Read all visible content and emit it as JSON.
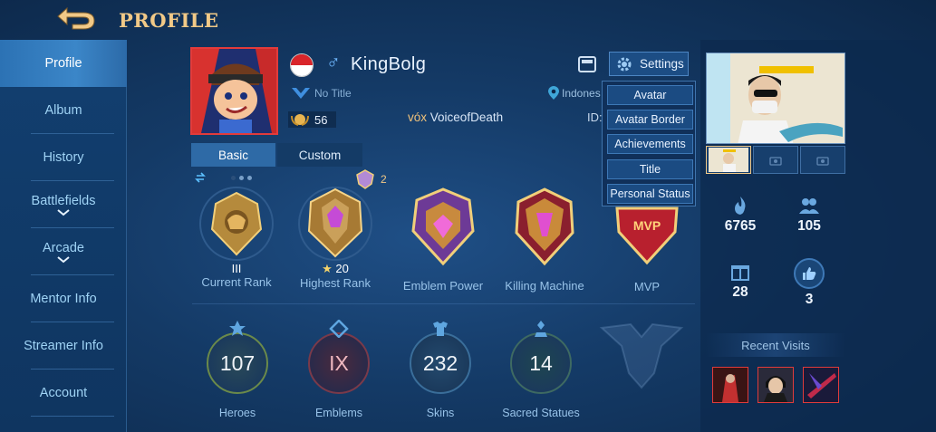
{
  "header": {
    "title": "PROFILE",
    "back_icon": "back-arrow-icon",
    "accent": "#f1c987"
  },
  "sidebar": {
    "items": [
      {
        "label": "Profile",
        "active": true
      },
      {
        "label": "Album"
      },
      {
        "label": "History"
      },
      {
        "label": "Battlefields",
        "expandable": true
      },
      {
        "label": "Arcade",
        "expandable": true
      },
      {
        "label": "Mentor Info"
      },
      {
        "label": "Streamer Info"
      },
      {
        "label": "Account"
      }
    ]
  },
  "profile": {
    "name": "KingBolg",
    "gender_symbol": "♂",
    "title": "No Title",
    "level": "56",
    "squad_tag": "vóx",
    "squad_name": "VoiceofDeath",
    "location": "Indones",
    "id_label": "ID:"
  },
  "settings": {
    "label": "Settings",
    "menu": [
      "Avatar",
      "Avatar Border",
      "Achievements",
      "Title",
      "Personal Status"
    ]
  },
  "tabs": [
    "Basic",
    "Custom"
  ],
  "badges": [
    {
      "label": "Current Rank",
      "value": "III"
    },
    {
      "label": "Highest Rank",
      "value": "20",
      "star": "★"
    },
    {
      "label": "Emblem Power",
      "value": ""
    },
    {
      "label": "Killing Machine",
      "value": ""
    },
    {
      "label": "MVP",
      "value": "",
      "text": "MVP"
    }
  ],
  "highest_rank_extra": "2",
  "circle_stats": [
    {
      "label": "Heroes",
      "value": "107",
      "color": "#d4c36a"
    },
    {
      "label": "Emblems",
      "value": "IX",
      "color": "#d97a8a"
    },
    {
      "label": "Skins",
      "value": "232",
      "color": "#79b8e6"
    },
    {
      "label": "Sacred Statues",
      "value": "14",
      "color": "#9ad1b8"
    }
  ],
  "right_stats": [
    {
      "value": "6765",
      "icon": "flame-icon"
    },
    {
      "value": "105",
      "icon": "followers-icon"
    },
    {
      "value": "28",
      "icon": "gift-icon"
    },
    {
      "value": "3",
      "icon": "thumbs-up-icon"
    }
  ],
  "recent_visits": {
    "title": "Recent Visits"
  }
}
